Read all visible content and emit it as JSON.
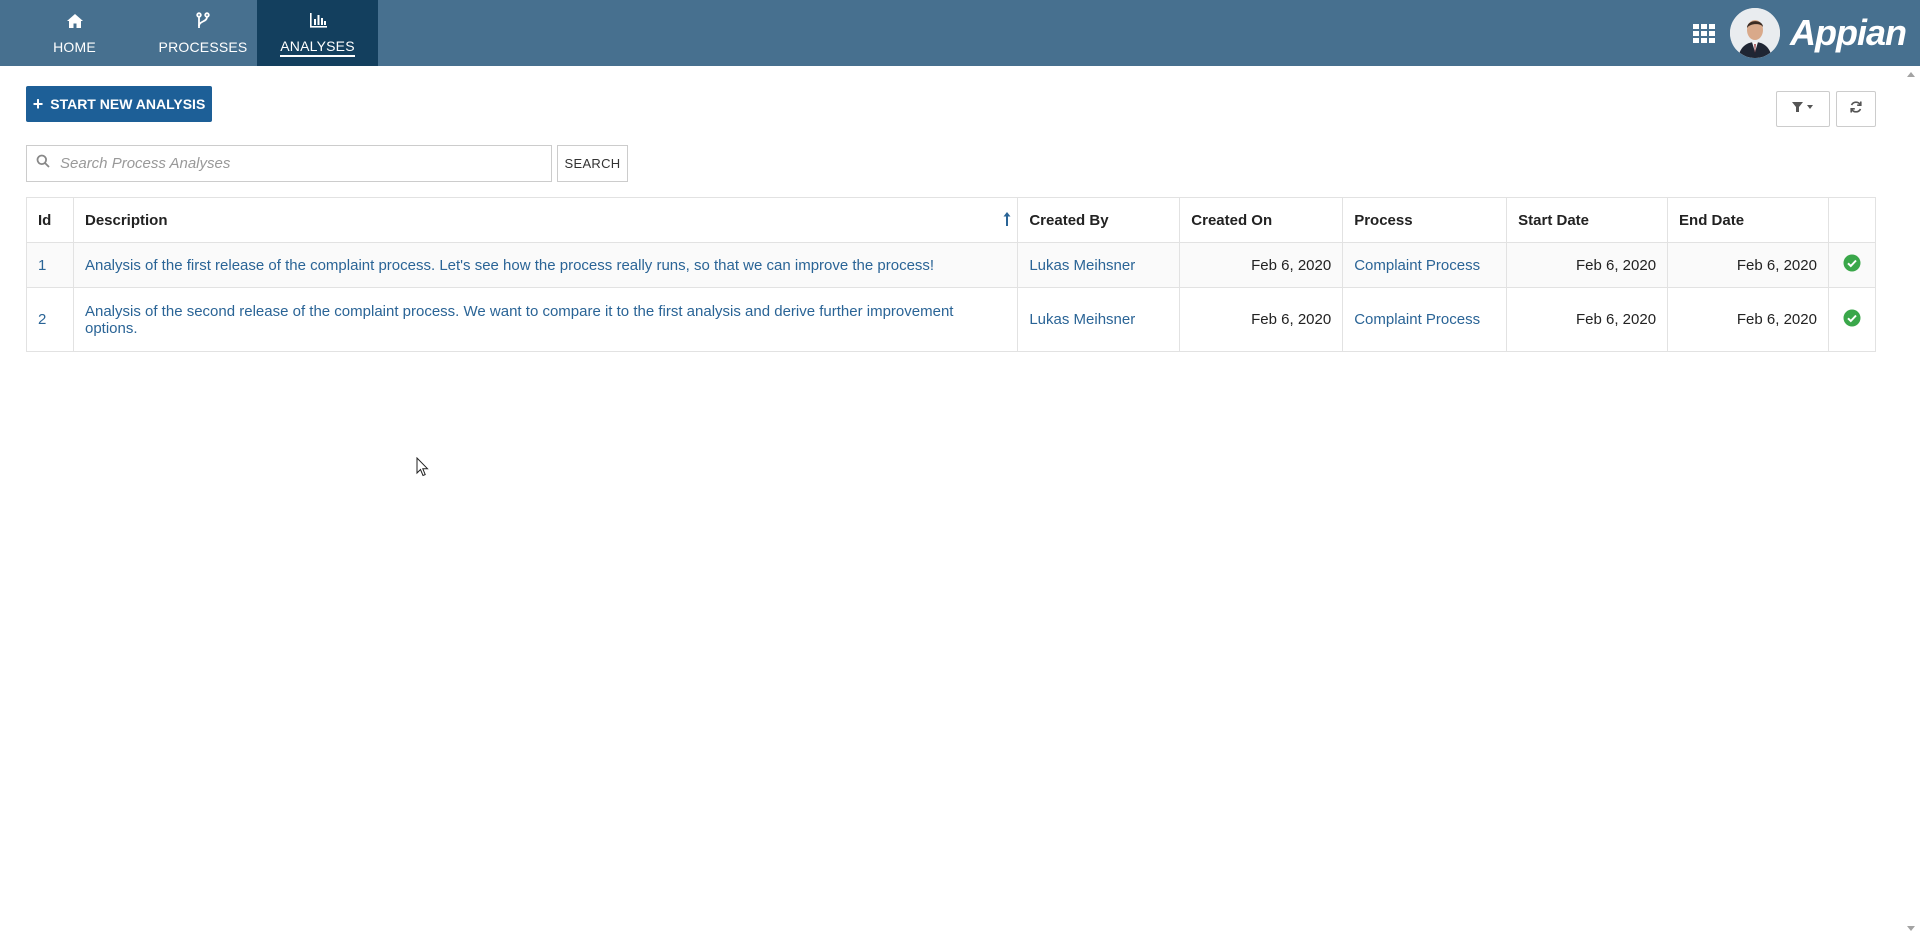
{
  "nav": {
    "tabs": [
      {
        "label": "HOME",
        "icon": "home-icon"
      },
      {
        "label": "PROCESSES",
        "icon": "branch-icon"
      },
      {
        "label": "ANALYSES",
        "icon": "bar-chart-icon",
        "active": true
      }
    ]
  },
  "header": {
    "brand": "Appian",
    "apps_icon": "grid-icon",
    "avatar": "user-avatar"
  },
  "toolbar": {
    "start_label": "START NEW ANALYSIS",
    "filter_icon": "filter-icon",
    "refresh_icon": "refresh-icon"
  },
  "search": {
    "placeholder": "Search Process Analyses",
    "value": "",
    "button_label": "SEARCH"
  },
  "table": {
    "columns": [
      "Id",
      "Description",
      "Created By",
      "Created On",
      "Process",
      "Start Date",
      "End Date"
    ],
    "sort_column": "Description",
    "rows": [
      {
        "id": "1",
        "description": "Analysis of the first release of the complaint process. Let's see how the process really runs, so that we can improve the process!",
        "created_by": "Lukas Meihsner",
        "created_on": "Feb 6, 2020",
        "process": "Complaint Process",
        "start_date": "Feb 6, 2020",
        "end_date": "Feb 6, 2020",
        "status": "complete"
      },
      {
        "id": "2",
        "description": "Analysis of the second release of the complaint process. We want to compare it to the first analysis and derive further improvement options.",
        "created_by": "Lukas Meihsner",
        "created_on": "Feb 6, 2020",
        "process": "Complaint Process",
        "start_date": "Feb 6, 2020",
        "end_date": "Feb 6, 2020",
        "status": "complete"
      }
    ]
  },
  "colors": {
    "topbar": "#47708f",
    "active_tab": "#133f5e",
    "primary_button": "#1d5f97",
    "link": "#2a6496",
    "status_ok": "#3aa74a"
  }
}
